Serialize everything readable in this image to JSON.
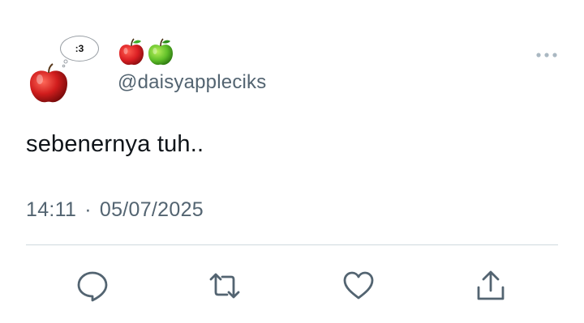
{
  "tweet": {
    "avatar": {
      "bubble_text": ":3",
      "icon": "red-apple-icon"
    },
    "display_name_icons": [
      "red-apple-icon",
      "green-apple-icon"
    ],
    "handle": "@daisyappleciks",
    "text": "sebenernya tuh..",
    "time": "14:11",
    "separator": "·",
    "date": "05/07/2025",
    "actions": {
      "reply_icon": "reply-icon",
      "retweet_icon": "retweet-icon",
      "like_icon": "heart-icon",
      "share_icon": "share-icon"
    }
  },
  "colors": {
    "text_primary": "#0f1419",
    "text_secondary": "#536471",
    "divider": "#cfd9de",
    "icon": "#536471"
  }
}
